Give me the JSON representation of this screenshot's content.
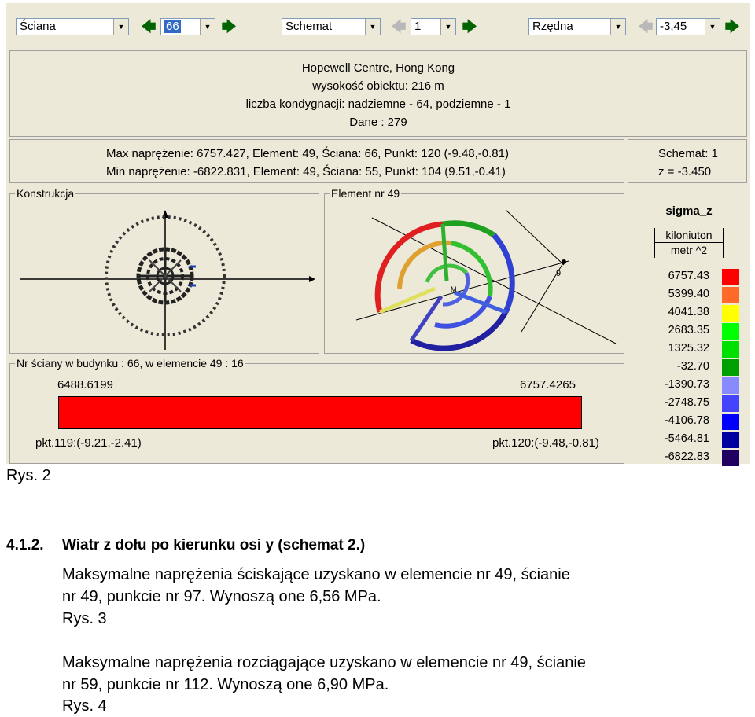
{
  "toolbar": {
    "wall_select": "Ściana",
    "wall_number": "66",
    "scheme_select": "Schemat",
    "scheme_number": "1",
    "ordinate_select": "Rzędna",
    "ordinate_value": "-3,45"
  },
  "header": {
    "line1": "Hopewell Centre, Hong Kong",
    "line2": "wysokość obiektu: 216 m",
    "line3": "liczba kondygnacji: nadziemne - 64, podziemne - 1",
    "line4": "Dane :  279"
  },
  "stress": {
    "max_line": "Max naprężenie: 6757.427,   Element: 49,   Ściana: 66,   Punkt: 120 (-9.48,-0.81)",
    "min_line": "Min naprężenie: -6822.831,   Element: 49,   Ściana: 55,   Punkt: 104 (9.51,-0.41)"
  },
  "scheme_box": {
    "line1": "Schemat: 1",
    "line2": "z = -3.450"
  },
  "groups": {
    "construction": "Konstrukcja",
    "element": "Element nr 49",
    "wall": "Nr ściany w budynku :  66,   w elemencie 49 :  16"
  },
  "wall_plot": {
    "left_value": "6488.6199",
    "right_value": "6757.4265",
    "left_point": "pkt.119:(-9.21,-2.41)",
    "right_point": "pkt.120:(-9.48,-0.81)",
    "bar_color": "#ff0000"
  },
  "legend": {
    "title": "sigma_z",
    "unit_top": "kiloniuton",
    "unit_bottom": "metr ^2",
    "items": [
      {
        "value": "6757.43",
        "color": "#ff0000"
      },
      {
        "value": "5399.40",
        "color": "#ff6a2a"
      },
      {
        "value": "4041.38",
        "color": "#ffff00"
      },
      {
        "value": "2683.35",
        "color": "#00ff00"
      },
      {
        "value": "1325.32",
        "color": "#00e000"
      },
      {
        "value": "-32.70",
        "color": "#00a000"
      },
      {
        "value": "-1390.73",
        "color": "#8888ff"
      },
      {
        "value": "-2748.75",
        "color": "#4444ff"
      },
      {
        "value": "-4106.78",
        "color": "#0000ff"
      },
      {
        "value": "-5464.81",
        "color": "#0000a0"
      },
      {
        "value": "-6822.83",
        "color": "#200060"
      }
    ]
  },
  "doc": {
    "caption2": "Rys. 2",
    "section_num": "4.1.2.",
    "section_title": "Wiatr z dołu po kierunku osi y (schemat 2.)",
    "para1_line1": "Maksymalne naprężenia ściskające uzyskano w elemencie nr 49, ścianie",
    "para1_line2": "nr 49, punkcie nr 97. Wynoszą one 6,56 MPa.",
    "caption3": "Rys. 3",
    "para2_line1": "Maksymalne naprężenia rozciągające uzyskano w elemencie nr 49, ścianie",
    "para2_line2": "nr 59, punkcie nr 112. Wynoszą one 6,90 MPa.",
    "caption4": "Rys. 4"
  }
}
